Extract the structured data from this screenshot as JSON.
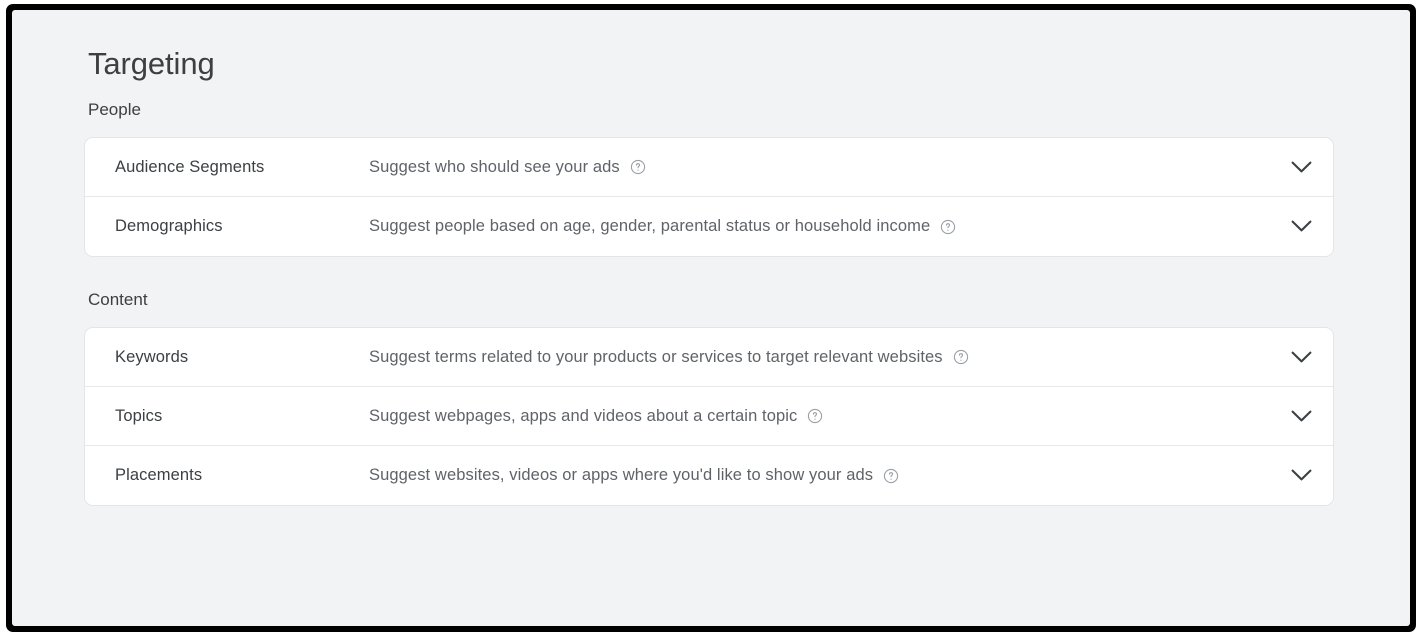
{
  "page": {
    "title": "Targeting"
  },
  "sections": [
    {
      "label": "People",
      "rows": [
        {
          "label": "Audience Segments",
          "description": "Suggest who should see your ads",
          "help_icon": "help-circle-icon",
          "expand_icon": "chevron-down-icon"
        },
        {
          "label": "Demographics",
          "description": "Suggest people based on age, gender, parental status or household income",
          "help_icon": "help-circle-icon",
          "expand_icon": "chevron-down-icon"
        }
      ]
    },
    {
      "label": "Content",
      "rows": [
        {
          "label": "Keywords",
          "description": "Suggest terms related to your products or services to target relevant websites",
          "help_icon": "help-circle-icon",
          "expand_icon": "chevron-down-icon"
        },
        {
          "label": "Topics",
          "description": "Suggest webpages, apps and videos about a certain topic",
          "help_icon": "help-circle-icon",
          "expand_icon": "chevron-down-icon"
        },
        {
          "label": "Placements",
          "description": "Suggest websites, videos or apps where you'd like to show your ads",
          "help_icon": "help-circle-icon",
          "expand_icon": "chevron-down-icon"
        }
      ]
    }
  ],
  "colors": {
    "page_background": "#f1f3f4",
    "card_background": "#ffffff",
    "primary_text": "#3c4043",
    "secondary_text": "#5f6368",
    "divider": "#e6e8ea",
    "icon_muted": "#9aa0a6",
    "frame": "#000000"
  }
}
